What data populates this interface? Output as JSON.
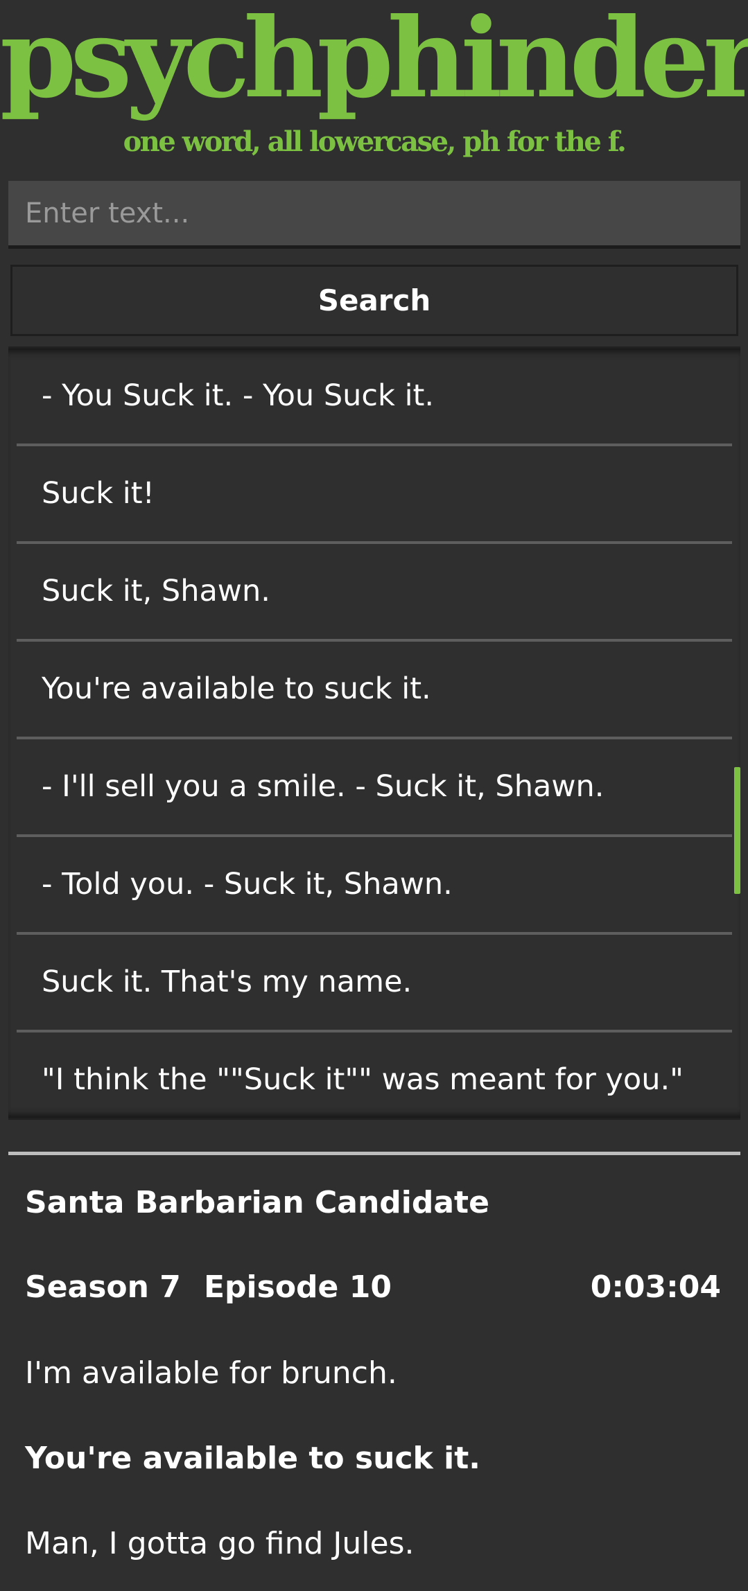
{
  "header": {
    "logo_text": "psychphinder",
    "tagline": "one word, all lowercase, ph for the f."
  },
  "search": {
    "placeholder": "Enter text...",
    "value": "",
    "button_label": "Search"
  },
  "results": {
    "items": [
      {
        "text": "- You Suck it. - You Suck it.",
        "selected": false
      },
      {
        "text": "Suck it!",
        "selected": false
      },
      {
        "text": "Suck it, Shawn.",
        "selected": false
      },
      {
        "text": "You're available to suck it.",
        "selected": true
      },
      {
        "text": "- I'll sell you a smile. - Suck it, Shawn.",
        "selected": false
      },
      {
        "text": "- Told you. - Suck it, Shawn.",
        "selected": false
      },
      {
        "text": "Suck it. That's my name.",
        "selected": false
      },
      {
        "text": "\"I think the \"\"Suck it\"\" was meant for you.\"",
        "selected": false
      }
    ]
  },
  "detail": {
    "episode_title": "Santa Barbarian Candidate",
    "season": "Season 7",
    "episode": "Episode 10",
    "timestamp": "0:03:04",
    "lines": {
      "previous": "I'm available for brunch.",
      "current": "You're available to suck it.",
      "next": "Man, I gotta go find Jules."
    }
  },
  "colors": {
    "accent": "#7dc142",
    "background": "#2f2f2f",
    "input_background": "#474747"
  }
}
